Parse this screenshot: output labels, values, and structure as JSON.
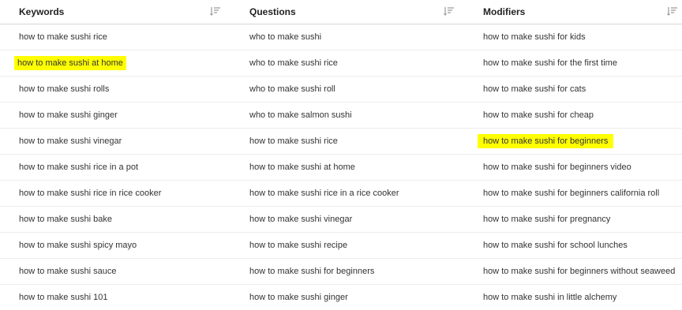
{
  "columns": [
    {
      "title": "Keywords",
      "rows": [
        "how to make sushi rice",
        "how to make sushi at home",
        "how to make sushi rolls",
        "how to make sushi ginger",
        "how to make sushi vinegar",
        "how to make sushi rice in a pot",
        "how to make sushi rice in rice cooker",
        "how to make sushi bake",
        "how to make sushi spicy mayo",
        "how to make sushi sauce",
        "how to make sushi 101"
      ]
    },
    {
      "title": "Questions",
      "rows": [
        "who to make sushi",
        "who to make sushi rice",
        "who to make sushi roll",
        "who to make salmon sushi",
        "how to make sushi rice",
        "how to make sushi at home",
        "how to make sushi rice in a rice cooker",
        "how to make sushi vinegar",
        "how to make sushi recipe",
        "how to make sushi for beginners",
        "how to make sushi ginger"
      ]
    },
    {
      "title": "Modifiers",
      "rows": [
        "how to make sushi for kids",
        "how to make sushi for the first time",
        "how to make sushi for cats",
        "how to make sushi for cheap",
        "how to make sushi for beginners",
        "how to make sushi for beginners video",
        "how to make sushi for beginners california roll",
        "how to make sushi for pregnancy",
        "how to make sushi for school lunches",
        "how to make sushi for beginners without seaweed",
        "how to make sushi in little alchemy"
      ]
    }
  ],
  "highlight_color": "#ffff00",
  "sort_icon": "sort-icon"
}
